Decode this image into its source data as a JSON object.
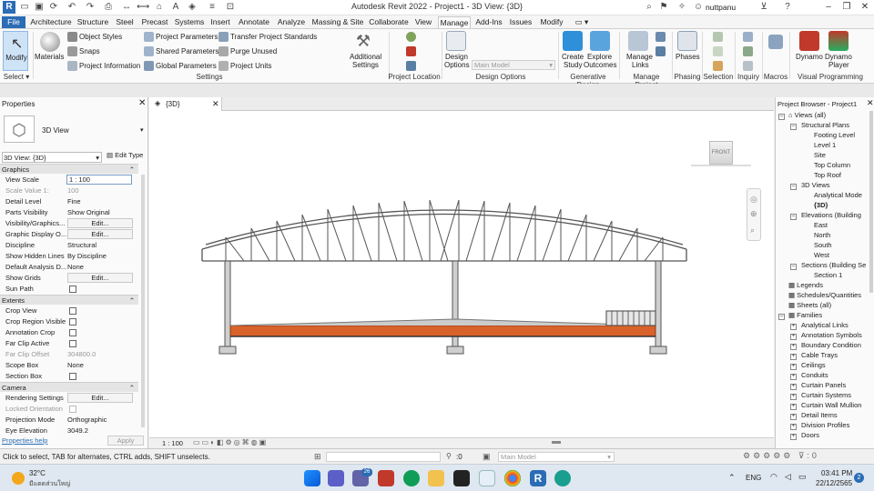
{
  "window": {
    "title": "Autodesk Revit 2022 - Project1 - 3D View: {3D}",
    "user": "nuttpanu"
  },
  "tabs": [
    "File",
    "Architecture",
    "Structure",
    "Steel",
    "Precast",
    "Systems",
    "Insert",
    "Annotate",
    "Analyze",
    "Massing & Site",
    "Collaborate",
    "View",
    "Manage",
    "Add-Ins",
    "Issues",
    "Modify"
  ],
  "active_tab": "Manage",
  "ribbon": {
    "select": {
      "modify": "Modify",
      "panel": "Select"
    },
    "settings": {
      "materials": "Materials",
      "object_styles": "Object Styles",
      "snaps": "Snaps",
      "project_information": "Project Information",
      "project_parameters": "Project Parameters",
      "shared_parameters": "Shared Parameters",
      "global_parameters": "Global Parameters",
      "transfer_project_standards": "Transfer Project Standards",
      "purge_unused": "Purge Unused",
      "project_units": "Project Units",
      "additional_settings_1": "Additional",
      "additional_settings_2": "Settings",
      "panel": "Settings"
    },
    "project_location": {
      "panel": "Project Location"
    },
    "design_options": {
      "btn_1": "Design",
      "btn_2": "Options",
      "main_model": "Main Model",
      "panel": "Design Options"
    },
    "generative_design": {
      "create_1": "Create",
      "create_2": "Study",
      "explore_1": "Explore",
      "explore_2": "Outcomes",
      "panel": "Generative Design"
    },
    "manage_project": {
      "btn_1": "Manage",
      "btn_2": "Links",
      "panel": "Manage Project"
    },
    "phasing": {
      "btn": "Phases",
      "panel": "Phasing"
    },
    "selection": {
      "panel": "Selection"
    },
    "inquiry": {
      "panel": "Inquiry"
    },
    "macros": {
      "panel": "Macros"
    },
    "visual_programming": {
      "dynamo": "Dynamo",
      "player_1": "Dynamo",
      "player_2": "Player",
      "panel": "Visual Programming"
    }
  },
  "properties": {
    "title": "Properties",
    "type_name": "3D View",
    "selector": "3D View: {3D}",
    "edit_type": "Edit Type",
    "groups": {
      "graphics": "Graphics",
      "extents": "Extents",
      "camera": "Camera"
    },
    "rows": {
      "view_scale": [
        "View Scale",
        "1 : 100"
      ],
      "scale_value": [
        "Scale Value    1:",
        "100"
      ],
      "detail_level": [
        "Detail Level",
        "Fine"
      ],
      "parts_visibility": [
        "Parts Visibility",
        "Show Original"
      ],
      "vis_graphics": [
        "Visibility/Graphics...",
        "Edit..."
      ],
      "graphic_display": [
        "Graphic Display O...",
        "Edit..."
      ],
      "discipline": [
        "Discipline",
        "Structural"
      ],
      "hidden_lines": [
        "Show Hidden Lines",
        "By Discipline"
      ],
      "analysis_display": [
        "Default Analysis D...",
        "None"
      ],
      "show_grids": [
        "Show Grids",
        "Edit..."
      ],
      "sun_path": [
        "Sun Path",
        ""
      ],
      "crop_view": [
        "Crop View",
        ""
      ],
      "crop_region_visible": [
        "Crop Region Visible",
        ""
      ],
      "annotation_crop": [
        "Annotation Crop",
        ""
      ],
      "far_clip_active": [
        "Far Clip Active",
        ""
      ],
      "far_clip_offset": [
        "Far Clip Offset",
        "304800.0"
      ],
      "scope_box": [
        "Scope Box",
        "None"
      ],
      "section_box": [
        "Section Box",
        ""
      ],
      "rendering_settings": [
        "Rendering Settings",
        "Edit..."
      ],
      "locked_orientation": [
        "Locked Orientation",
        ""
      ],
      "projection_mode": [
        "Projection Mode",
        "Orthographic"
      ],
      "eye_elevation": [
        "Eye Elevation",
        "3049.2"
      ]
    },
    "help": "Properties help",
    "apply": "Apply"
  },
  "view": {
    "tab_label": "{3D}",
    "viewcube": "FRONT",
    "scale": "1 : 100"
  },
  "browser": {
    "title": "Project Browser - Project1",
    "items": {
      "views_all": "Views (all)",
      "structural_plans": "Structural Plans",
      "footing_level": "Footing Level",
      "level_1": "Level 1",
      "site": "Site",
      "top_column": "Top Column",
      "top_roof": "Top Roof",
      "3d_views": "3D Views",
      "analytical_model": "Analytical Mode",
      "3d": "{3D}",
      "elevations": "Elevations (Building",
      "east": "East",
      "north": "North",
      "south": "South",
      "west": "West",
      "sections": "Sections (Building Se",
      "section_1": "Section 1",
      "legends": "Legends",
      "schedules": "Schedules/Quantities",
      "sheets": "Sheets (all)",
      "families": "Families",
      "analytical_links": "Analytical Links",
      "annotation_symbols": "Annotation Symbols",
      "boundary_conditions": "Boundary Condition",
      "cable_trays": "Cable Trays",
      "ceilings": "Ceilings",
      "conduits": "Conduits",
      "curtain_panels": "Curtain Panels",
      "curtain_systems": "Curtain Systems",
      "curtain_wall_mullions": "Curtain Wall Mullion",
      "detail_items": "Detail Items",
      "division_profiles": "Division Profiles",
      "doors": "Doors"
    }
  },
  "status": {
    "hint": "Click to select, TAB for alternates, CTRL adds, SHIFT unselects.",
    "zero": ":0",
    "main_model": "Main Model"
  },
  "taskbar": {
    "temp": "32°C",
    "weather": "มีแดดส่วนใหญ่",
    "lang": "ENG",
    "time": "03:41 PM",
    "date": "22/12/2565",
    "badge": "2",
    "teams_badge": "26"
  },
  "colors": {
    "accent": "#2b6cb5",
    "slab": "#d9622a",
    "steel": "#555555"
  }
}
